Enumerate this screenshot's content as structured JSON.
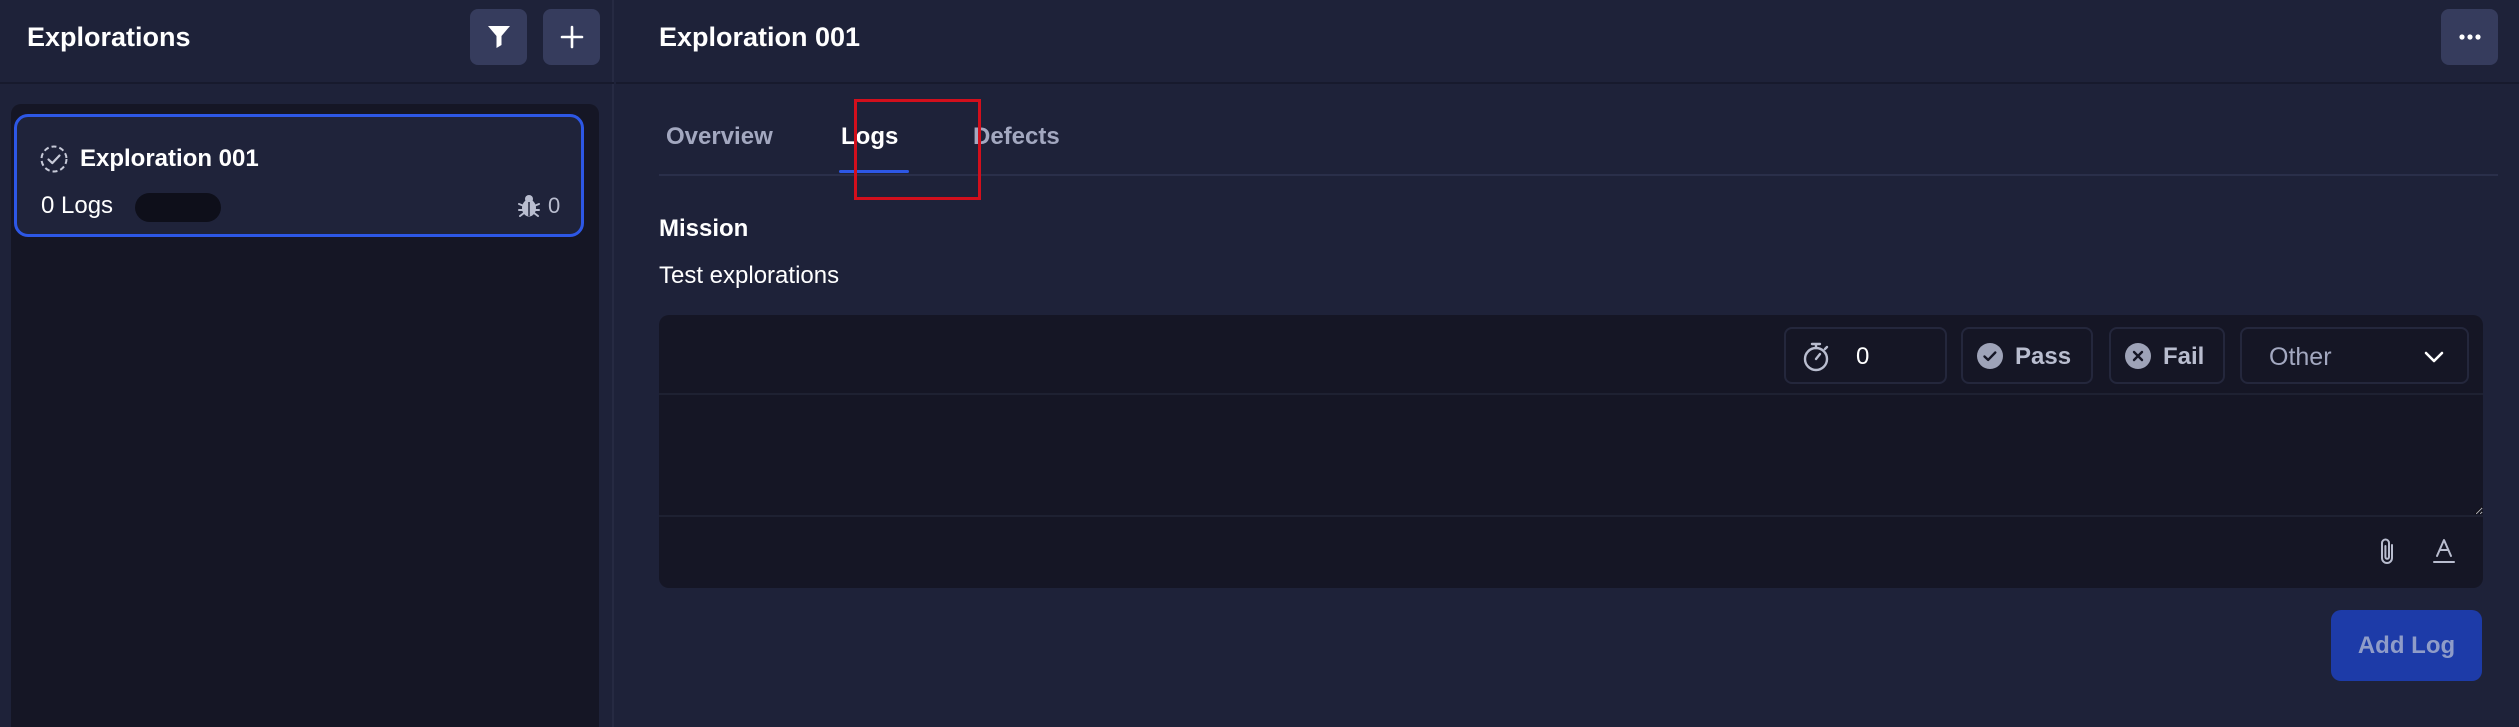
{
  "sidebar": {
    "title": "Explorations",
    "filter_icon": "filter-icon",
    "add_icon": "plus-icon",
    "items": [
      {
        "title": "Exploration 001",
        "logs_label": "0 Logs",
        "defects_count": "0",
        "status_icon": "dashed-check-circle-icon",
        "defects_icon": "bug-icon"
      }
    ]
  },
  "main": {
    "title": "Exploration 001",
    "more_icon": "ellipsis-icon",
    "tabs": [
      {
        "label": "Overview"
      },
      {
        "label": "Logs",
        "active": true
      },
      {
        "label": "Defects"
      }
    ],
    "mission": {
      "label": "Mission",
      "text": "Test explorations"
    },
    "log_editor": {
      "timer_value": "0",
      "timer_icon": "stopwatch-icon",
      "pass_label": "Pass",
      "pass_icon": "check-circle-icon",
      "fail_label": "Fail",
      "fail_icon": "x-circle-icon",
      "type_value": "Other",
      "type_icon": "chevron-down-icon",
      "attach_icon": "paperclip-icon",
      "format_icon": "text-format-icon",
      "add_button_label": "Add Log"
    }
  },
  "colors": {
    "background": "#1e2239",
    "panel": "#151625",
    "accent": "#2d57e5",
    "button": "#363c5d",
    "highlight_box": "#d20f1c",
    "add_button": "#1d3ba8"
  }
}
